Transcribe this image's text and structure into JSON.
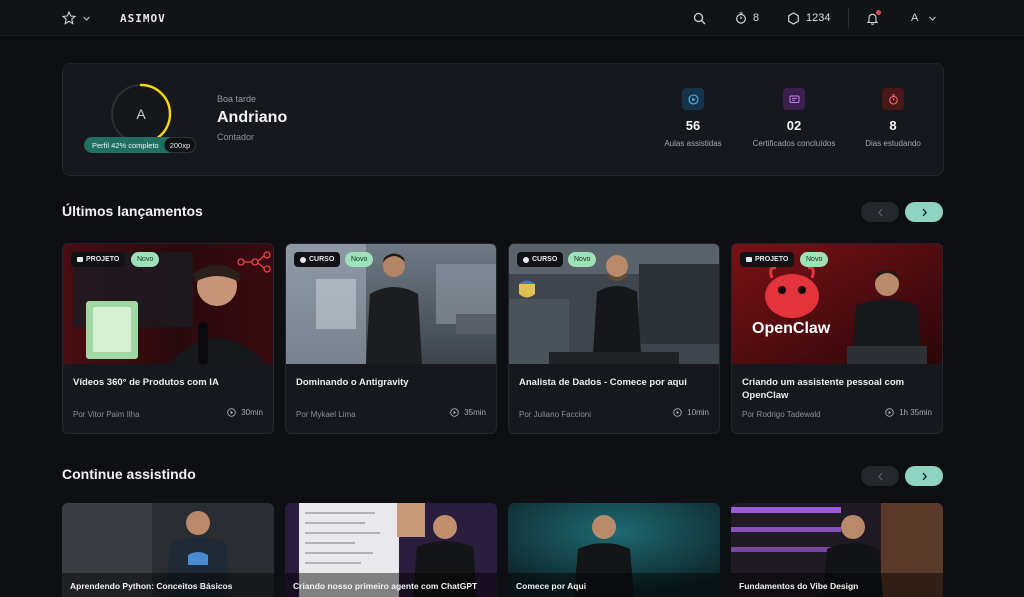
{
  "topbar": {
    "brand": "ASIMOV",
    "streak": "8",
    "coins": "1234",
    "user_initial": "A"
  },
  "profile": {
    "initial": "A",
    "progress_fraction": 0.42,
    "progress_label": "Perfil 42% completo",
    "xp_label": "200xp",
    "greeting": "Boa tarde",
    "name": "Andriano",
    "role": "Contador",
    "stats": [
      {
        "value": "56",
        "label": "Aulas assistidas",
        "icon": "play-circle-icon",
        "color": "#4aa3df"
      },
      {
        "value": "02",
        "label": "Certificados concluídos",
        "icon": "certificate-icon",
        "color": "#b56ae0"
      },
      {
        "value": "8",
        "label": "Dias estudando",
        "icon": "stopwatch-icon",
        "color": "#e55a5a"
      }
    ]
  },
  "latest": {
    "title": "Últimos lançamentos",
    "cards": [
      {
        "type": "PROJETO",
        "badge": "Novo",
        "title": "Vídeos 360° de Produtos com IA",
        "author": "Por Vitor Paim Ilha",
        "duration": "30min"
      },
      {
        "type": "CURSO",
        "badge": "Novo",
        "title": "Dominando o Antigravity",
        "author": "Por Mykael Lima",
        "duration": "35min"
      },
      {
        "type": "CURSO",
        "badge": "Novo",
        "title": "Analista de Dados - Comece por aqui",
        "author": "Por Juliano Faccioni",
        "duration": "10min"
      },
      {
        "type": "PROJETO",
        "badge": "Novo",
        "title": "Criando um assistente pessoal com OpenClaw",
        "author": "Por Rodrigo Tadewald",
        "duration": "1h 35min",
        "thumb_text": "OpenClaw"
      }
    ]
  },
  "continue": {
    "title": "Continue assistindo",
    "cards": [
      {
        "title": "Aprendendo Python: Conceitos Básicos"
      },
      {
        "title": "Criando nosso primeiro agente com ChatGPT"
      },
      {
        "title": "Comece por Aqui"
      },
      {
        "title": "Fundamentos do Vibe Design"
      }
    ]
  },
  "colors": {
    "accent": "#8fd3c3",
    "new_badge": "#9ee2b8",
    "progress": "#f5d90a",
    "xp_pill": "#1f6f63"
  }
}
